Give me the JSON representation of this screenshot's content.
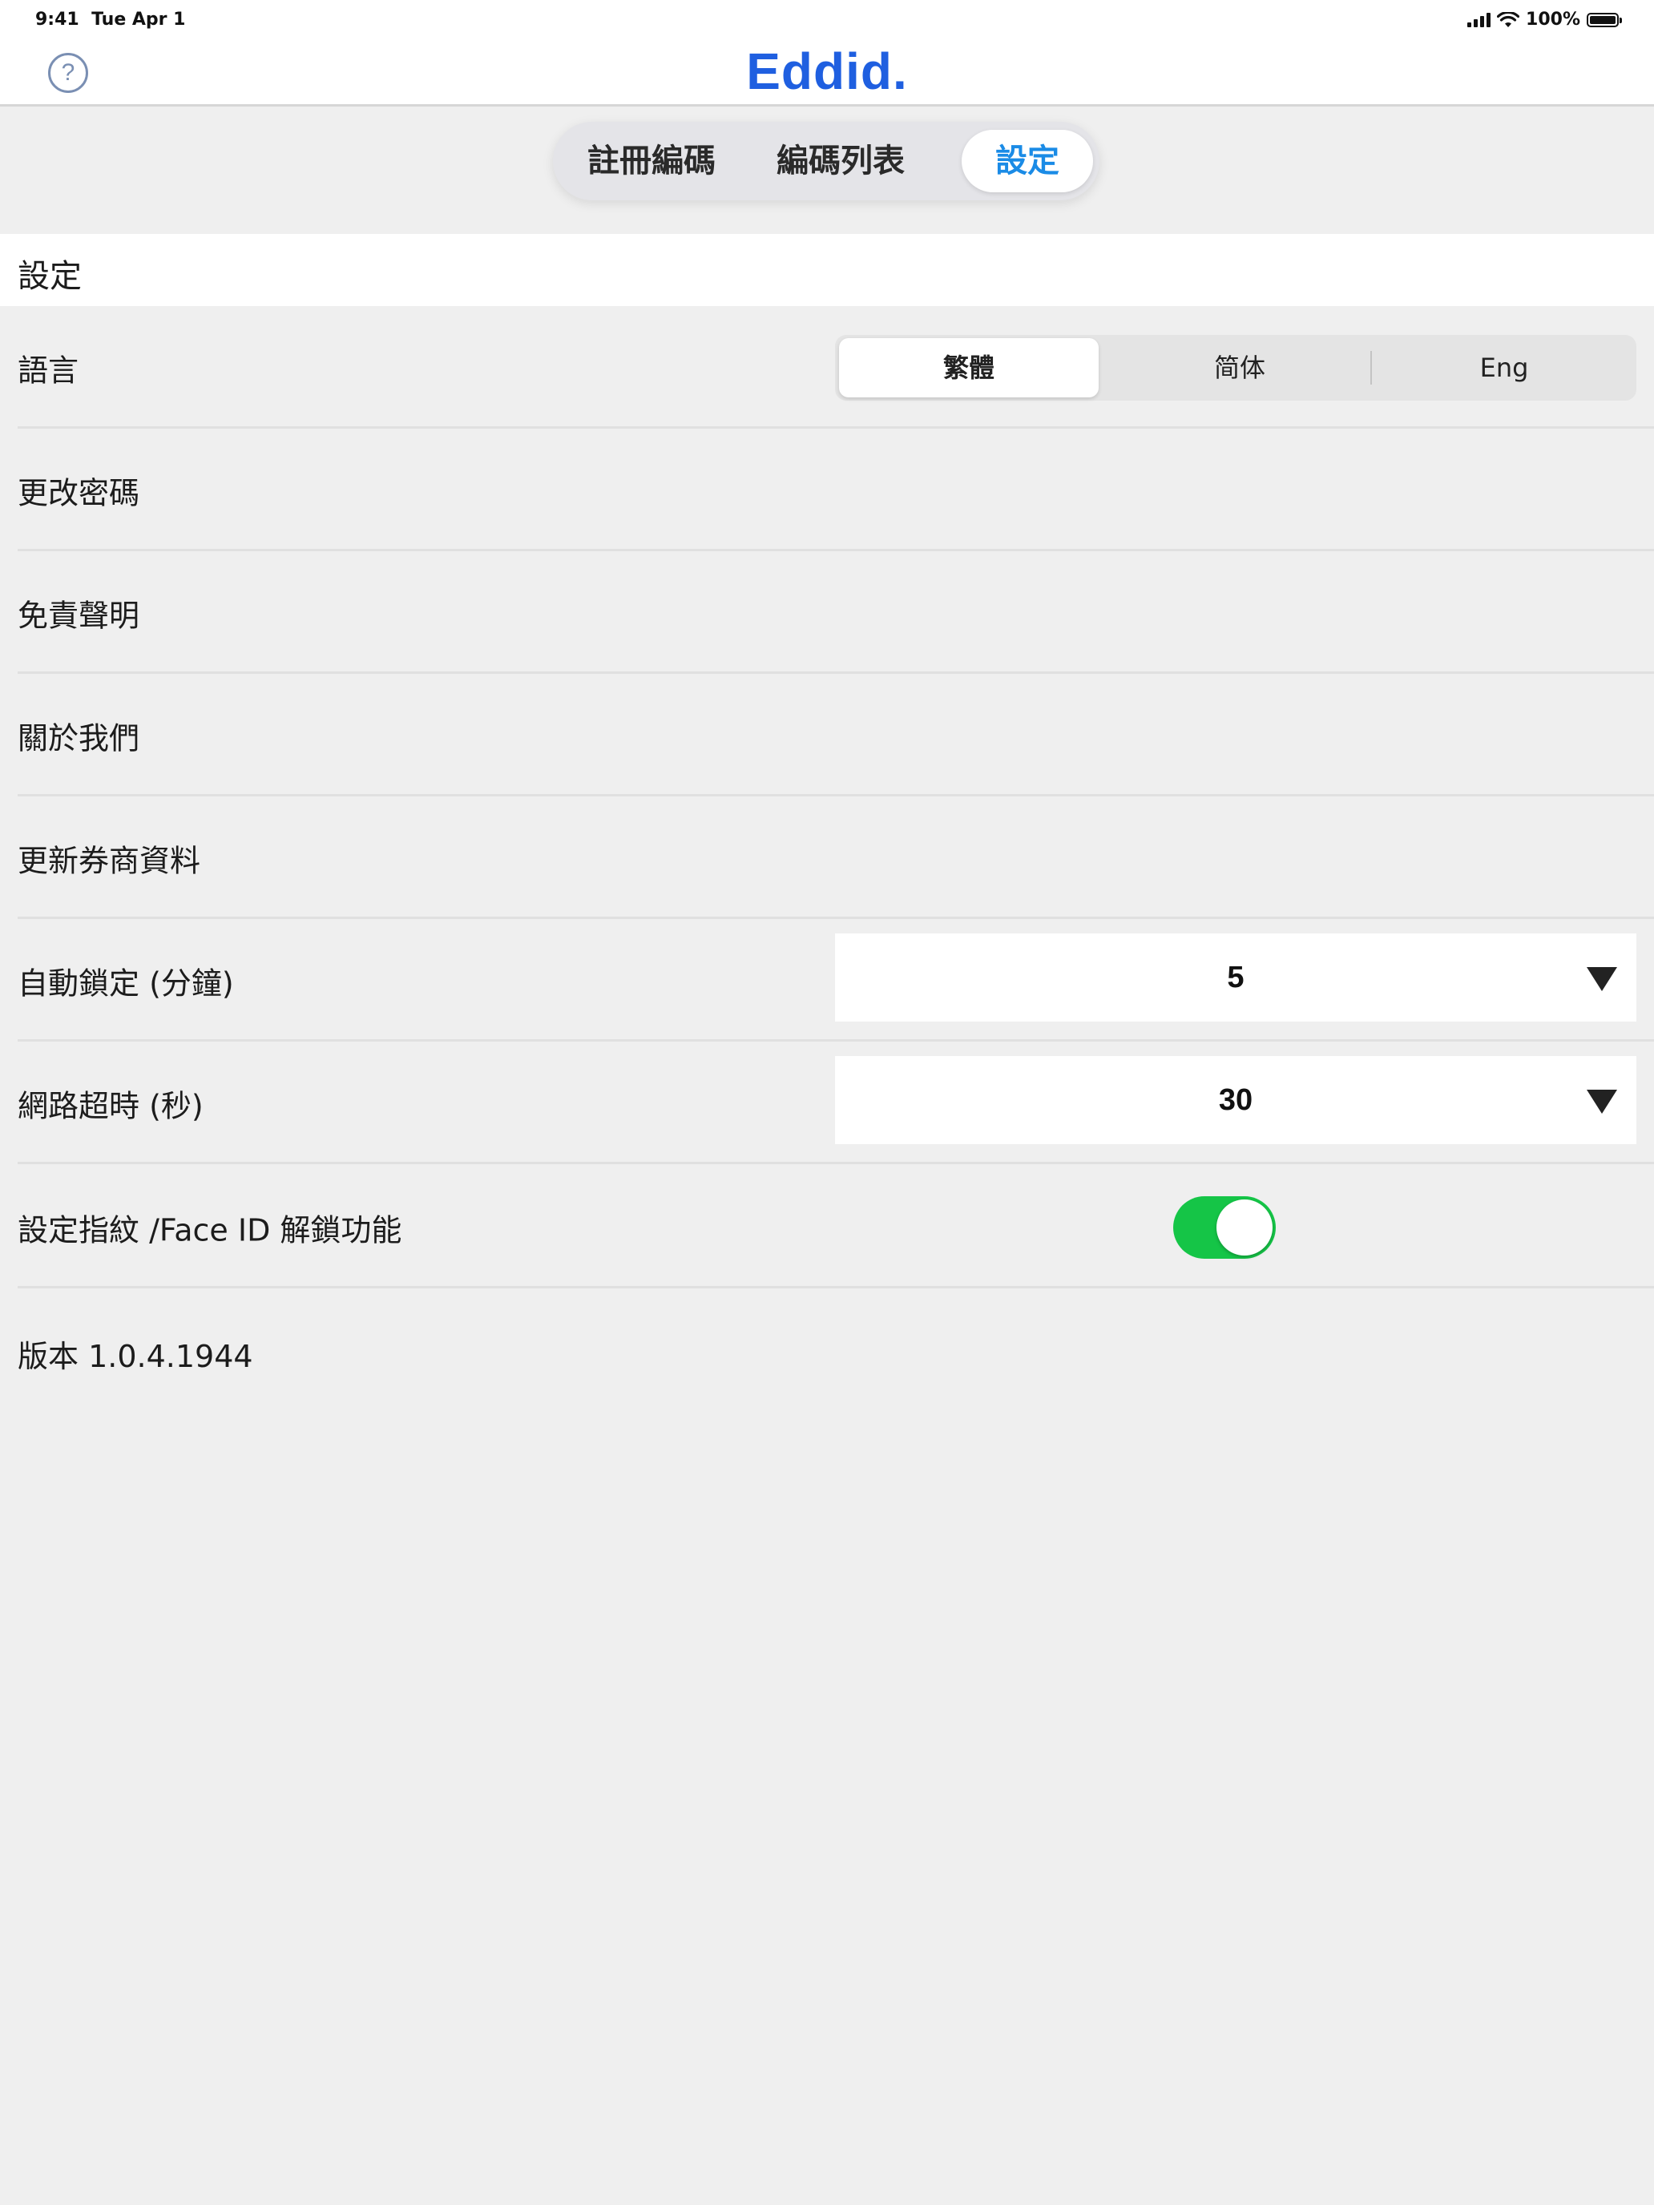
{
  "status_bar": {
    "time": "9:41",
    "date": "Tue Apr 1",
    "battery": "100%"
  },
  "header": {
    "logo": "Eddid.",
    "help_glyph": "?",
    "brand_color": "#1f5fe0"
  },
  "tabs": [
    {
      "label": "註冊編碼",
      "selected": false
    },
    {
      "label": "編碼列表",
      "selected": false
    },
    {
      "label": "設定",
      "selected": true
    }
  ],
  "section": {
    "title": "設定"
  },
  "settings": {
    "language": {
      "label": "語言",
      "options": [
        "繁體",
        "简体",
        "Eng"
      ],
      "selected": "繁體"
    },
    "change_password": {
      "label": "更改密碼"
    },
    "disclaimer": {
      "label": "免責聲明"
    },
    "about_us": {
      "label": "關於我們"
    },
    "update_broker": {
      "label": "更新券商資料"
    },
    "auto_lock": {
      "label": "自動鎖定 (分鐘)",
      "value": "5"
    },
    "network_timeout": {
      "label": "網路超時 (秒)",
      "value": "30"
    },
    "biometric": {
      "label": "設定指紋 /Face ID 解鎖功能",
      "enabled": true,
      "on_color": "#15c547"
    }
  },
  "version": "版本 1.0.4.1944"
}
